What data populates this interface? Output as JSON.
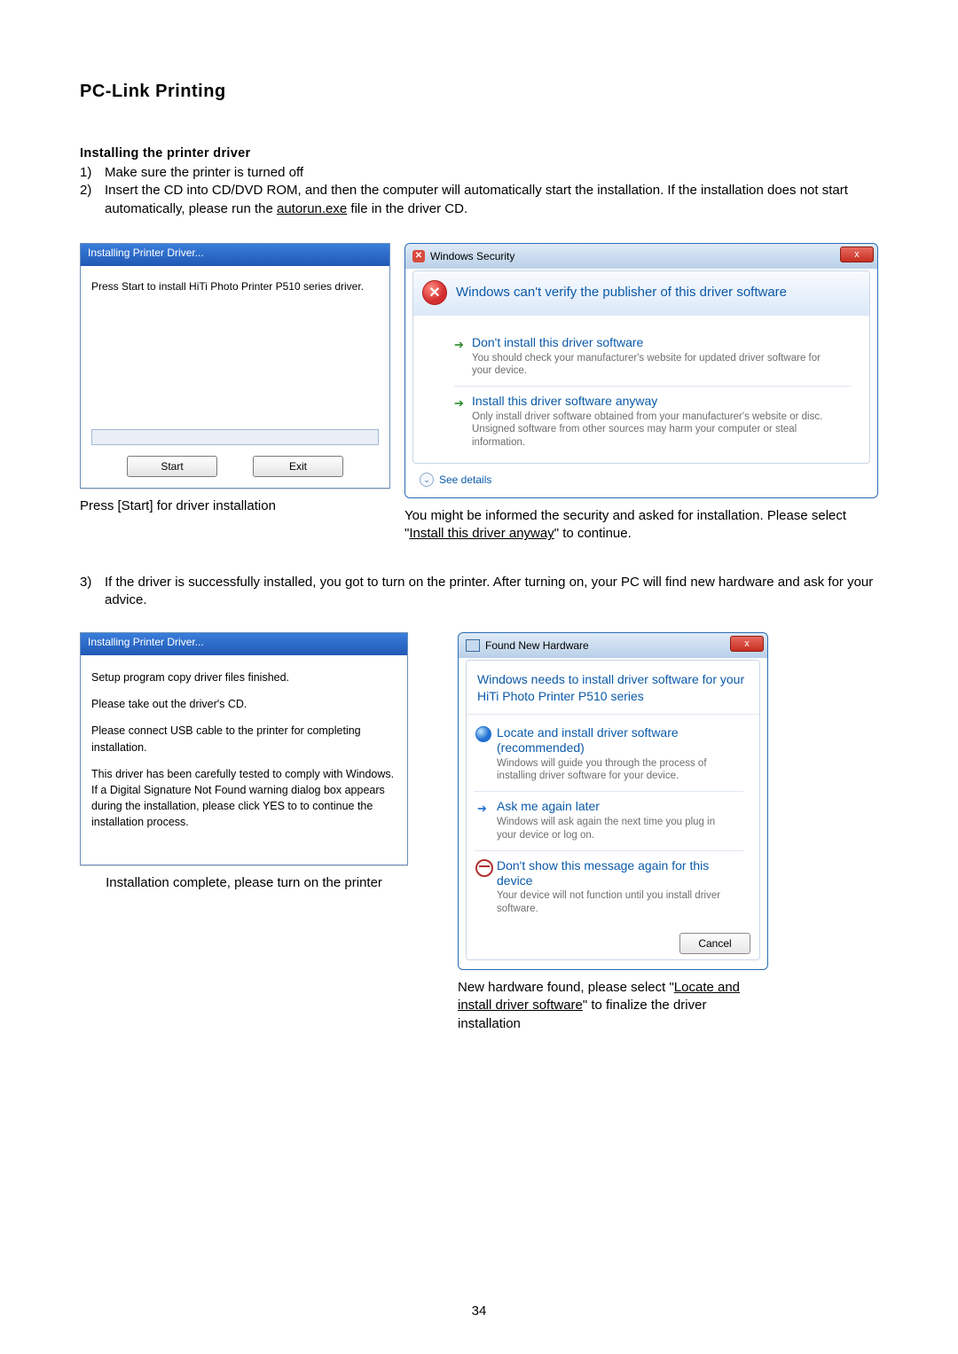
{
  "heading": "PC-Link Printing",
  "sub": "Installing the printer driver",
  "steps_a": [
    {
      "n": "1)",
      "t": "Make sure the printer is turned off"
    },
    {
      "n": "2)",
      "t_pre": "Insert the CD into CD/DVD ROM, and then the computer will automatically start the installation.   If the installation does not start automatically, please run the ",
      "t_u": "autorun.exe",
      "t_post": " file in the driver CD."
    }
  ],
  "installer1": {
    "title": "Installing Printer Driver...",
    "msg": "Press Start to install HiTi Photo Printer P510 series driver.",
    "start": "Start",
    "exit": "Exit"
  },
  "caption1": "Press [Start] for driver installation",
  "security": {
    "title": "Windows Security",
    "close": "x",
    "header": "Windows can't verify the publisher of this driver software",
    "opt1": {
      "t": "Don't install this driver software",
      "d": "You should check your manufacturer's website for updated driver software for your device."
    },
    "opt2": {
      "t": "Install this driver software anyway",
      "d": "Only install driver software obtained from your manufacturer's website or disc. Unsigned software from other sources may harm your computer or steal information."
    },
    "details": "See details"
  },
  "caption2_pre": "You might be informed the security and asked for installation.   Please select \"",
  "caption2_u": "Install this driver anyway",
  "caption2_post": "\" to continue.",
  "step3": {
    "n": "3)",
    "t": "If the driver is successfully installed, you got to turn on the printer.   After turning on, your PC will find new hardware and ask for your advice."
  },
  "installer2": {
    "title": "Installing Printer Driver...",
    "l1": "Setup program copy driver files finished.",
    "l2": "Please take out the driver's CD.",
    "l3": "Please connect USB cable to the printer for completing installation.",
    "l4": "This driver has been carefully tested to comply with Windows. If a Digital Signature Not Found warning dialog box appears during the installation, please click YES to to continue the installation process."
  },
  "caption3": "Installation complete, please turn on the printer",
  "found": {
    "title": "Found New Hardware",
    "close": "x",
    "header": "Windows needs to install driver software for your HiTi Photo Printer P510 series",
    "opt1": {
      "t": "Locate and install driver software (recommended)",
      "d": "Windows will guide you through the process of installing driver software for your device."
    },
    "opt2": {
      "t": "Ask me again later",
      "d": "Windows will ask again the next time you plug in your device or log on."
    },
    "opt3": {
      "t": "Don't show this message again for this device",
      "d": "Your device will not function until you install driver software."
    },
    "cancel": "Cancel"
  },
  "caption4_pre": "New hardware found, please select \"",
  "caption4_u": "Locate and install driver software",
  "caption4_post": "\" to finalize the driver installation",
  "page": "34"
}
